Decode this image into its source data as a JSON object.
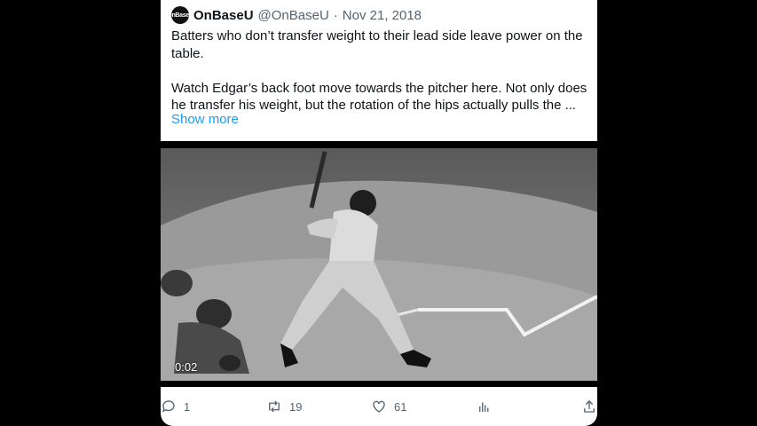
{
  "tweet": {
    "avatar_text": "OnBaseU",
    "display_name": "OnBaseU",
    "handle": "@OnBaseU",
    "separator": "·",
    "date": "Nov 21, 2018",
    "paragraph1": "Batters who don’t transfer weight to their lead side leave power on the table.",
    "paragraph2": "Watch Edgar’s back foot move towards the pitcher here. Not only does he transfer his weight, but the rotation of the hips actually pulls the ...",
    "show_more": "Show more"
  },
  "video": {
    "timestamp": "0:02"
  },
  "actions": {
    "replies": "1",
    "retweets": "19",
    "likes": "61",
    "icons": [
      "reply-icon",
      "retweet-icon",
      "like-icon",
      "analytics-icon",
      "share-icon"
    ]
  },
  "colors": {
    "link": "#1d9bf0",
    "text": "#0f1419",
    "muted": "#536471",
    "backdrop": "#000000"
  }
}
